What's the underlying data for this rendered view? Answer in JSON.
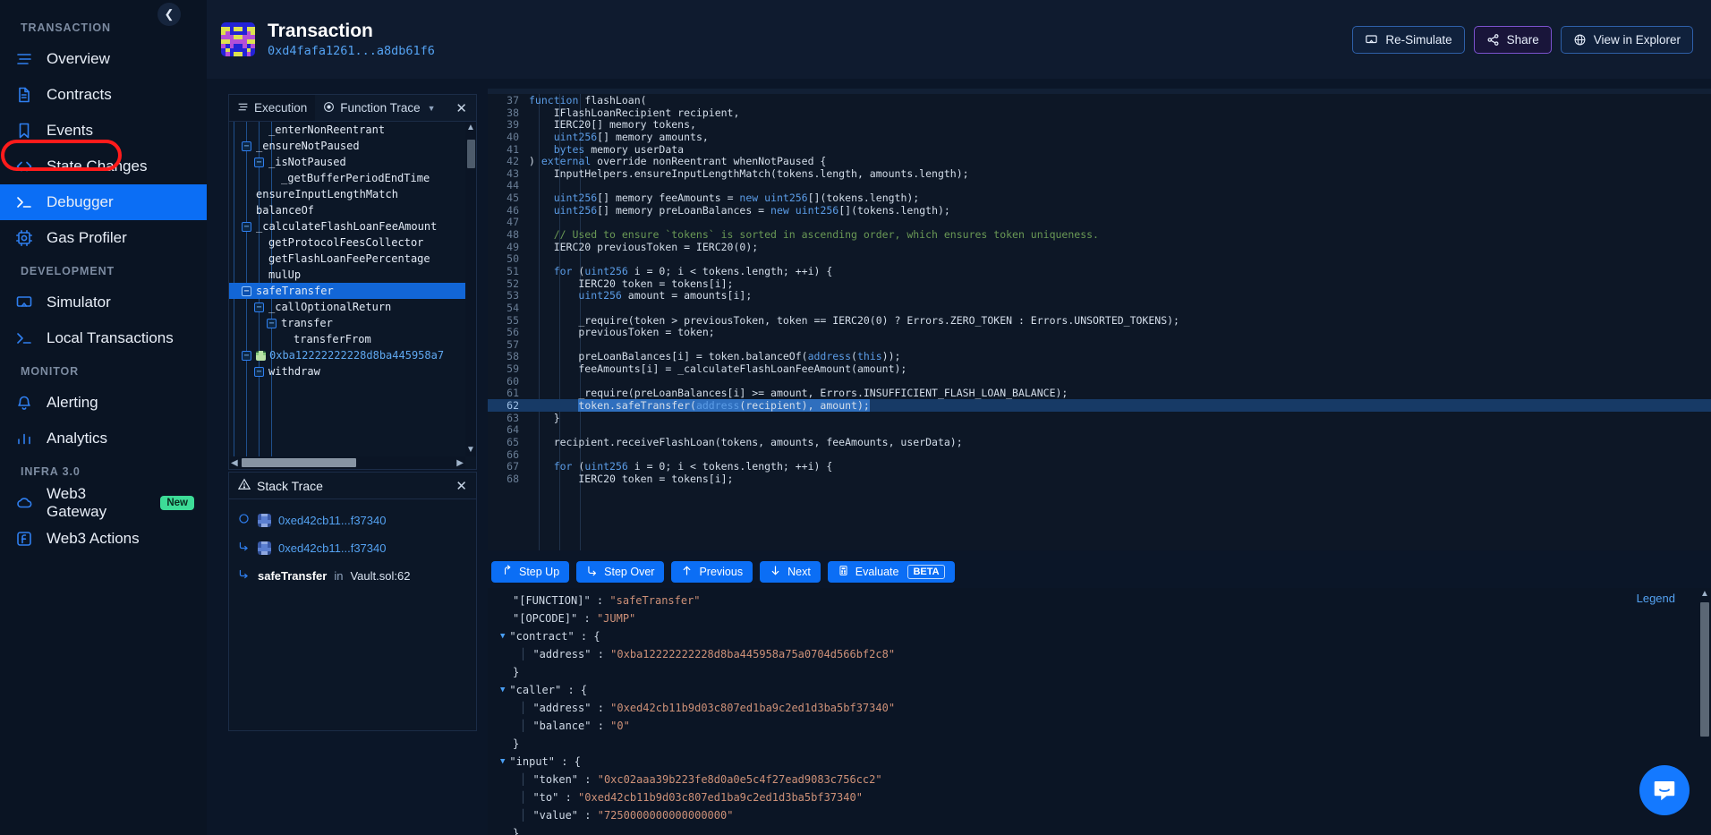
{
  "sidebar": {
    "collapse_icon": "chevron-left-icon",
    "groups": [
      {
        "label": "TRANSACTION",
        "items": [
          {
            "label": "Overview",
            "icon": "list-icon",
            "active": false
          },
          {
            "label": "Contracts",
            "icon": "document-icon",
            "active": false
          },
          {
            "label": "Events",
            "icon": "bookmark-icon",
            "active": false
          },
          {
            "label": "State Changes",
            "icon": "code-brackets-icon",
            "active": false
          },
          {
            "label": "Debugger",
            "icon": "terminal-icon",
            "active": true
          },
          {
            "label": "Gas Profiler",
            "icon": "cpu-icon",
            "active": false
          }
        ]
      },
      {
        "label": "DEVELOPMENT",
        "items": [
          {
            "label": "Simulator",
            "icon": "monitor-icon",
            "active": false
          },
          {
            "label": "Local Transactions",
            "icon": "terminal-icon",
            "active": false
          }
        ]
      },
      {
        "label": "MONITOR",
        "items": [
          {
            "label": "Alerting",
            "icon": "bell-icon",
            "active": false
          },
          {
            "label": "Analytics",
            "icon": "bar-chart-icon",
            "active": false
          }
        ]
      },
      {
        "label": "INFRA 3.0",
        "items": [
          {
            "label": "Web3 Gateway",
            "icon": "cloud-icon",
            "active": false,
            "badge": "New"
          },
          {
            "label": "Web3 Actions",
            "icon": "function-icon",
            "active": false
          }
        ]
      }
    ]
  },
  "header": {
    "title": "Transaction",
    "hash": "0xd4fafa1261...a8db61f6",
    "actions": [
      {
        "label": "Re-Simulate",
        "icon": "monitor-icon",
        "style": "blue"
      },
      {
        "label": "Share",
        "icon": "share-icon",
        "style": "purple"
      },
      {
        "label": "View in Explorer",
        "icon": "globe-icon",
        "style": "blue"
      }
    ]
  },
  "trace_panel": {
    "tab_execution": "Execution",
    "tab_function_trace": "Function Trace",
    "close_icon": "close-icon",
    "nodes": [
      {
        "label": "_enterNonReentrant",
        "depth": 4,
        "toggle": null,
        "selected": false,
        "type": "fn"
      },
      {
        "label": "_ensureNotPaused",
        "depth": 3,
        "toggle": "minus",
        "selected": false,
        "type": "fn"
      },
      {
        "label": "_isNotPaused",
        "depth": 4,
        "toggle": "minus",
        "selected": false,
        "type": "fn"
      },
      {
        "label": "_getBufferPeriodEndTime",
        "depth": 5,
        "toggle": null,
        "selected": false,
        "type": "fn"
      },
      {
        "label": "ensureInputLengthMatch",
        "depth": 3,
        "toggle": null,
        "selected": false,
        "type": "fn"
      },
      {
        "label": "balanceOf",
        "depth": 3,
        "toggle": null,
        "selected": false,
        "type": "fn"
      },
      {
        "label": "_calculateFlashLoanFeeAmount",
        "depth": 3,
        "toggle": "minus",
        "selected": false,
        "type": "fn"
      },
      {
        "label": "getProtocolFeesCollector",
        "depth": 4,
        "toggle": null,
        "selected": false,
        "type": "fn"
      },
      {
        "label": "getFlashLoanFeePercentage",
        "depth": 4,
        "toggle": null,
        "selected": false,
        "type": "fn"
      },
      {
        "label": "mulUp",
        "depth": 4,
        "toggle": null,
        "selected": false,
        "type": "fn"
      },
      {
        "label": "safeTransfer",
        "depth": 3,
        "toggle": "minus",
        "selected": true,
        "type": "fn"
      },
      {
        "label": "_callOptionalReturn",
        "depth": 4,
        "toggle": "minus",
        "selected": false,
        "type": "fn"
      },
      {
        "label": "transfer",
        "depth": 5,
        "toggle": "minus",
        "selected": false,
        "type": "fn"
      },
      {
        "label": "transferFrom",
        "depth": 6,
        "toggle": null,
        "selected": false,
        "type": "fn"
      },
      {
        "label": "0xba12222222228d8ba445958a7",
        "depth": 3,
        "toggle": "minus",
        "selected": false,
        "type": "address"
      },
      {
        "label": "withdraw",
        "depth": 4,
        "toggle": "minus",
        "selected": false,
        "type": "fn"
      }
    ]
  },
  "stack_trace": {
    "title": "Stack Trace",
    "warning_icon": "warning-icon",
    "close_icon": "close-icon",
    "rows": [
      {
        "icon": "circle-icon",
        "blockie": true,
        "address": "0xed42cb11...f37340"
      },
      {
        "icon": "arrow-return-icon",
        "blockie": true,
        "address": "0xed42cb11...f37340"
      },
      {
        "icon": "arrow-return-icon",
        "blockie": false,
        "fn": "safeTransfer",
        "in": "in",
        "location": "Vault.sol:62"
      }
    ]
  },
  "editor": {
    "highlighted_line": 62,
    "lines": [
      {
        "n": 37,
        "text": "function flashLoan(",
        "kw": [
          "function"
        ]
      },
      {
        "n": 38,
        "text": "    IFlashLoanRecipient recipient,",
        "kw": []
      },
      {
        "n": 39,
        "text": "    IERC20[] memory tokens,",
        "kw": []
      },
      {
        "n": 40,
        "text": "    uint256[] memory amounts,",
        "kw": [
          "uint256"
        ]
      },
      {
        "n": 41,
        "text": "    bytes memory userData",
        "kw": [
          "bytes"
        ]
      },
      {
        "n": 42,
        "text": ") external override nonReentrant whenNotPaused {",
        "kw": [
          "external"
        ]
      },
      {
        "n": 43,
        "text": "    InputHelpers.ensureInputLengthMatch(tokens.length, amounts.length);",
        "kw": []
      },
      {
        "n": 44,
        "text": "",
        "kw": []
      },
      {
        "n": 45,
        "text": "    uint256[] memory feeAmounts = new uint256[](tokens.length);",
        "kw": [
          "uint256",
          "new",
          "uint256"
        ]
      },
      {
        "n": 46,
        "text": "    uint256[] memory preLoanBalances = new uint256[](tokens.length);",
        "kw": [
          "uint256",
          "new",
          "uint256"
        ]
      },
      {
        "n": 47,
        "text": "",
        "kw": []
      },
      {
        "n": 48,
        "text": "    // Used to ensure `tokens` is sorted in ascending order, which ensures token uniqueness.",
        "comment": true
      },
      {
        "n": 49,
        "text": "    IERC20 previousToken = IERC20(0);",
        "kw": []
      },
      {
        "n": 50,
        "text": "",
        "kw": []
      },
      {
        "n": 51,
        "text": "    for (uint256 i = 0; i < tokens.length; ++i) {",
        "kw": [
          "for",
          "uint256"
        ]
      },
      {
        "n": 52,
        "text": "        IERC20 token = tokens[i];",
        "kw": []
      },
      {
        "n": 53,
        "text": "        uint256 amount = amounts[i];",
        "kw": [
          "uint256"
        ]
      },
      {
        "n": 54,
        "text": "",
        "kw": []
      },
      {
        "n": 55,
        "text": "        _require(token > previousToken, token == IERC20(0) ? Errors.ZERO_TOKEN : Errors.UNSORTED_TOKENS);",
        "kw": []
      },
      {
        "n": 56,
        "text": "        previousToken = token;",
        "kw": []
      },
      {
        "n": 57,
        "text": "",
        "kw": []
      },
      {
        "n": 58,
        "text": "        preLoanBalances[i] = token.balanceOf(address(this));",
        "kw": [
          "address",
          "this"
        ]
      },
      {
        "n": 59,
        "text": "        feeAmounts[i] = _calculateFlashLoanFeeAmount(amount);",
        "kw": []
      },
      {
        "n": 60,
        "text": "",
        "kw": []
      },
      {
        "n": 61,
        "text": "        _require(preLoanBalances[i] >= amount, Errors.INSUFFICIENT_FLASH_LOAN_BALANCE);",
        "kw": []
      },
      {
        "n": 62,
        "text": "        token.safeTransfer(address(recipient), amount);",
        "kw": [
          "address"
        ]
      },
      {
        "n": 63,
        "text": "    }",
        "kw": []
      },
      {
        "n": 64,
        "text": "",
        "kw": []
      },
      {
        "n": 65,
        "text": "    recipient.receiveFlashLoan(tokens, amounts, feeAmounts, userData);",
        "kw": []
      },
      {
        "n": 66,
        "text": "",
        "kw": []
      },
      {
        "n": 67,
        "text": "    for (uint256 i = 0; i < tokens.length; ++i) {",
        "kw": [
          "for",
          "uint256"
        ]
      },
      {
        "n": 68,
        "text": "        IERC20 token = tokens[i];",
        "kw": []
      }
    ]
  },
  "debug_toolbar": {
    "buttons": [
      {
        "label": "Step Up",
        "icon": "arrow-up-turn-icon"
      },
      {
        "label": "Step Over",
        "icon": "arrow-right-turn-icon"
      },
      {
        "label": "Previous",
        "icon": "arrow-up-icon"
      },
      {
        "label": "Next",
        "icon": "arrow-down-icon"
      },
      {
        "label": "Evaluate",
        "icon": "calculator-icon",
        "badge": "BETA"
      }
    ]
  },
  "json_panel": {
    "legend_label": "Legend",
    "rows": [
      {
        "indent": 0,
        "tri": null,
        "bar": false,
        "key": "\"[FUNCTION]\"",
        "sep": " : ",
        "value": "\"safeTransfer\""
      },
      {
        "indent": 0,
        "tri": null,
        "bar": false,
        "key": "\"[OPCODE]\"",
        "sep": " : ",
        "value": "\"JUMP\""
      },
      {
        "indent": 0,
        "tri": "down",
        "bar": false,
        "key": "\"contract\"",
        "sep": " : ",
        "value": "{",
        "plain": true
      },
      {
        "indent": 1,
        "tri": null,
        "bar": true,
        "key": "\"address\"",
        "sep": " : ",
        "value": "\"0xba12222222228d8ba445958a75a0704d566bf2c8\""
      },
      {
        "indent": 0,
        "tri": null,
        "bar": false,
        "key": "}",
        "sep": "",
        "value": "",
        "plain": true
      },
      {
        "indent": 0,
        "tri": "down",
        "bar": false,
        "key": "\"caller\"",
        "sep": " : ",
        "value": "{",
        "plain": true
      },
      {
        "indent": 1,
        "tri": null,
        "bar": true,
        "key": "\"address\"",
        "sep": " : ",
        "value": "\"0xed42cb11b9d03c807ed1ba9c2ed1d3ba5bf37340\""
      },
      {
        "indent": 1,
        "tri": null,
        "bar": true,
        "key": "\"balance\"",
        "sep": " : ",
        "value": "\"0\""
      },
      {
        "indent": 0,
        "tri": null,
        "bar": false,
        "key": "}",
        "sep": "",
        "value": "",
        "plain": true
      },
      {
        "indent": 0,
        "tri": "down",
        "bar": false,
        "key": "\"input\"",
        "sep": " : ",
        "value": "{",
        "plain": true
      },
      {
        "indent": 1,
        "tri": null,
        "bar": true,
        "key": "\"token\"",
        "sep": " : ",
        "value": "\"0xc02aaa39b223fe8d0a0e5c4f27ead9083c756cc2\""
      },
      {
        "indent": 1,
        "tri": null,
        "bar": true,
        "key": "\"to\"",
        "sep": " : ",
        "value": "\"0xed42cb11b9d03c807ed1ba9c2ed1d3ba5bf37340\""
      },
      {
        "indent": 1,
        "tri": null,
        "bar": true,
        "key": "\"value\"",
        "sep": " : ",
        "value": "\"7250000000000000000\""
      },
      {
        "indent": 0,
        "tri": null,
        "bar": false,
        "key": "}",
        "sep": "",
        "value": "",
        "plain": true
      }
    ]
  },
  "intercom": {
    "icon": "chat-bubble-icon"
  },
  "colors": {
    "accent_blue": "#0b6ef5",
    "link_blue": "#54a2f2",
    "sidebar_bg": "#0a1423",
    "panel_bg": "#0c1727",
    "editor_bg": "#0d1726",
    "highlight_line": "#173a66",
    "json_string": "#ce9178",
    "comment_green": "#6a9955",
    "badge_new": "#3ddc97",
    "annotation_red": "#ff1b1b"
  }
}
